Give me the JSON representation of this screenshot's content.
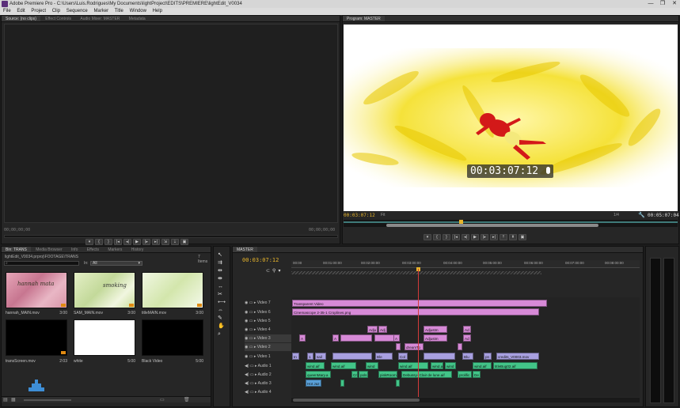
{
  "app": {
    "title": "Adobe Premiere Pro - C:\\Users\\Luis.Rodrigues\\My Documents\\lightProject\\EDITS\\PREMIERE\\lightEdit_V0034",
    "window_controls": [
      "—",
      "❐",
      "✕"
    ]
  },
  "menu": [
    "File",
    "Edit",
    "Project",
    "Clip",
    "Sequence",
    "Marker",
    "Title",
    "Window",
    "Help"
  ],
  "source_panel": {
    "tabs": [
      "Source: (no clips)",
      "Effect Controls",
      "Audio Mixer: MASTER",
      "Metadata"
    ],
    "tc_left": "00;00;00;00",
    "tc_right": "00;00;00;00"
  },
  "program_panel": {
    "tab": "Program: MASTER",
    "overlay_timecode": "00:03:07:12",
    "tc_current": "00:03:07:12",
    "fit_label": "Fit",
    "quality_label": "1/4",
    "tc_duration": "00:05:07:04"
  },
  "project_panel": {
    "tabs": [
      "Bin: TRANS",
      "Media Browser",
      "Info",
      "Effects",
      "Markers",
      "History"
    ],
    "path": "lightEdit_V0034.prproj\\FOOTAGE\\TRANS",
    "count": "7 Items",
    "in_label": "In:",
    "in_value": "All",
    "items": [
      {
        "name": "hannah_MAIN.mov",
        "duration": "3:00",
        "caption": "hannah mata"
      },
      {
        "name": "SAM_MAIN.mov",
        "duration": "3:00",
        "caption": "smoking"
      },
      {
        "name": "titleMAIN.mov",
        "duration": "3:00",
        "caption": ""
      },
      {
        "name": "transScreen.mov",
        "duration": "2:03",
        "caption": ""
      },
      {
        "name": "white",
        "duration": "5:00",
        "caption": ""
      },
      {
        "name": "Black Video",
        "duration": "5:00",
        "caption": ""
      }
    ]
  },
  "timeline": {
    "tab": "MASTER",
    "timecode": "00:03:07:12",
    "ruler": [
      "00:00",
      "00:01:00:00",
      "00:02:00:00",
      "00:03:00:00",
      "00:04:00:00",
      "00:05:00:00",
      "00:06:00:00",
      "00:07:00:00",
      "00:08:00:00"
    ],
    "tracks": [
      {
        "label": "Video 7",
        "type": "video"
      },
      {
        "label": "Video 6",
        "type": "video"
      },
      {
        "label": "Video 5",
        "type": "video"
      },
      {
        "label": "Video 4",
        "type": "video"
      },
      {
        "label": "Video 3",
        "type": "video"
      },
      {
        "label": "Video 2",
        "type": "video"
      },
      {
        "label": "Video 1",
        "type": "video"
      },
      {
        "label": "Audio 1",
        "type": "audio"
      },
      {
        "label": "Audio 2",
        "type": "audio"
      },
      {
        "label": "Audio 3",
        "type": "audio"
      },
      {
        "label": "Audio 4",
        "type": "audio"
      }
    ],
    "clips": {
      "v7": "Transparent Video",
      "v6": "Cinemascope 2-35-1 Croplines.png",
      "v4": [
        "Adju",
        "Adj",
        "Adjustm",
        "Ad"
      ],
      "v3": [
        "A",
        "A",
        "A",
        "Adjustm",
        "Ad"
      ],
      "v2": [
        "dreamTo"
      ],
      "v1": [
        "In",
        "sail",
        "1",
        "Ble",
        "Col",
        "Blu",
        "pn",
        "credits_V0003.mov"
      ],
      "a1": [
        "wind.aif",
        "wind.aif",
        "wind",
        "wind.aif",
        "wind.a",
        "wind",
        "wind.aif",
        "titleBug02.aif"
      ],
      "a2": [
        "queenMary.a",
        "Cr",
        "pols",
        "pinkRoom",
        "Debussy- Clair de lune.aif",
        "prolific",
        "De"
      ],
      "a3": [
        "Hot Jaz"
      ]
    }
  },
  "colors": {
    "accent": "#e6b42c",
    "playhead": "#d43a3a",
    "video_clip": "#d78ad7",
    "audio_clip": "#42c488"
  }
}
